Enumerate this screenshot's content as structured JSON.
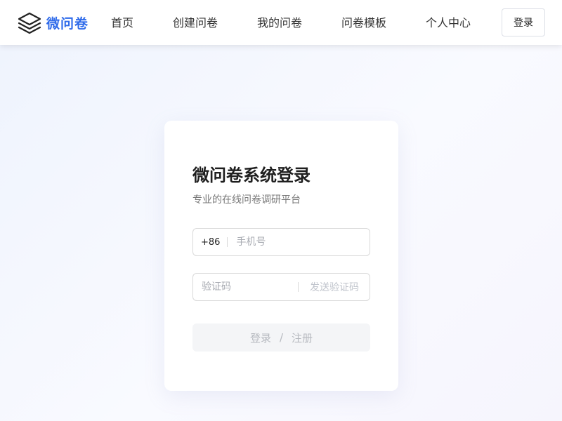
{
  "brand": {
    "name": "微问卷",
    "icon": "layers-icon",
    "color": "#2f6bea"
  },
  "nav": {
    "items": [
      {
        "label": "首页"
      },
      {
        "label": "创建问卷"
      },
      {
        "label": "我的问卷"
      },
      {
        "label": "问卷模板"
      },
      {
        "label": "个人中心"
      }
    ],
    "login_label": "登录"
  },
  "login_card": {
    "title": "微问卷系统登录",
    "subtitle": "专业的在线问卷调研平台",
    "phone": {
      "prefix": "+86",
      "placeholder": "手机号",
      "value": ""
    },
    "code": {
      "placeholder": "验证码",
      "value": "",
      "send_label": "发送验证码"
    },
    "submit": {
      "login_label": "登录",
      "separator": "/",
      "register_label": "注册"
    }
  }
}
